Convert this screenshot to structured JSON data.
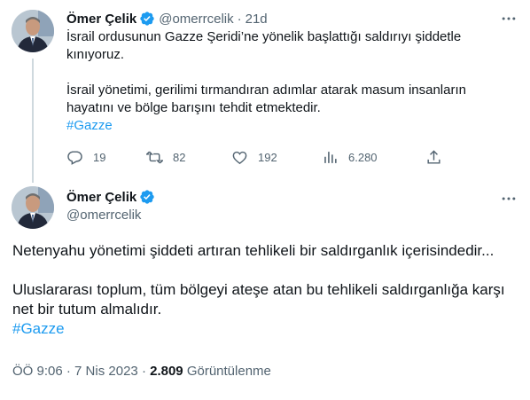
{
  "tweet1": {
    "author_name": "Ömer Çelik",
    "author_handle": "@omerrcelik",
    "separator": "·",
    "time": "21d",
    "paragraph1": "İsrail ordusunun Gazze Şeridi’ne yönelik başlattığı saldırıyı şiddetle kınıyoruz.",
    "paragraph2": "İsrail yönetimi, gerilimi tırmandıran adımlar atarak masum insanların hayatını ve bölge barışını tehdit etmektedir.",
    "hashtag": "#Gazze",
    "replies": "19",
    "retweets": "82",
    "likes": "192",
    "views": "6.280"
  },
  "tweet2": {
    "author_name": "Ömer Çelik",
    "author_handle": "@omerrcelik",
    "paragraph1": "Netenyahu yönetimi şiddeti  artıran tehlikeli bir saldırganlık içerisindedir...",
    "paragraph2": "Uluslararası toplum, tüm bölgeyi ateşe atan bu tehlikeli saldırganlığa karşı net bir tutum almalıdır.",
    "hashtag": "#Gazze",
    "time": "ÖÖ 9:06",
    "date_separator": "·",
    "date": "7 Nis 2023",
    "views_separator": "·",
    "views_count": "2.809",
    "views_label": "Görüntülenme"
  },
  "colors": {
    "accent": "#1d9bf0",
    "secondary_text": "#536471",
    "primary_text": "#0f1419",
    "thread_line": "#cfd9de"
  },
  "icons": [
    "verified-badge-icon",
    "more-icon",
    "reply-icon",
    "retweet-icon",
    "like-icon",
    "views-icon",
    "share-icon"
  ]
}
